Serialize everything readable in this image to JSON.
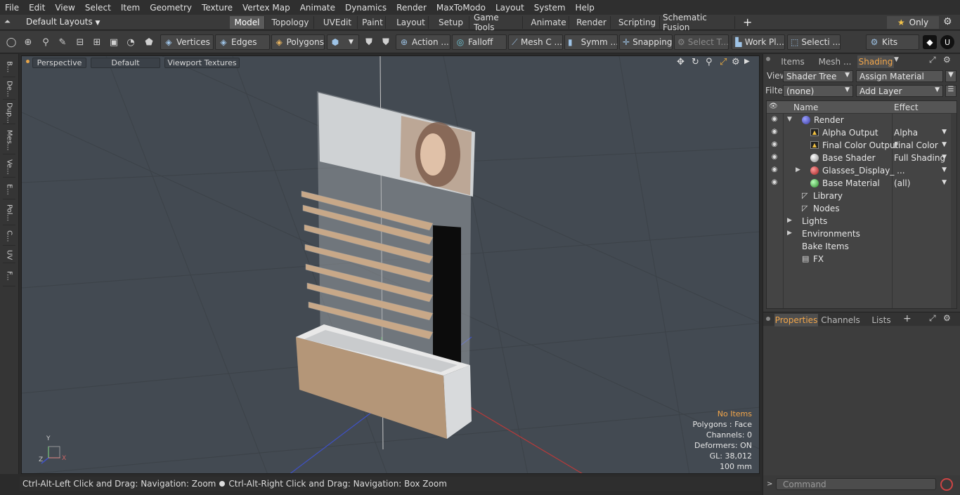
{
  "menu": [
    "File",
    "Edit",
    "View",
    "Select",
    "Item",
    "Geometry",
    "Texture",
    "Vertex Map",
    "Animate",
    "Dynamics",
    "Render",
    "MaxToModo",
    "Layout",
    "System",
    "Help"
  ],
  "layout": {
    "layouts_label": "Default Layouts",
    "tabs": [
      "Model",
      "Topology",
      "UVEdit",
      "Paint",
      "Layout",
      "Setup",
      "Game Tools",
      "Animate",
      "Render",
      "Scripting",
      "Schematic Fusion"
    ],
    "active_tab": "Model",
    "plus": "+",
    "only_label": "Only",
    "star": "★"
  },
  "toolbar": {
    "vertices": "Vertices",
    "edges": "Edges",
    "polygons": "Polygons",
    "action": "Action ...",
    "falloff": "Falloff",
    "mesh": "Mesh C ...",
    "symm": "Symm ...",
    "snapping": "Snapping",
    "select_t": "Select T...",
    "work_pl": "Work Pl...",
    "selecti": "Selecti ...",
    "kits": "Kits"
  },
  "left_tabs": [
    "B...",
    "De...",
    "Dup...",
    "Mes...",
    "Ve...",
    "E...",
    "Pol...",
    "C...",
    "UV",
    "F..."
  ],
  "viewport": {
    "perspective": "Perspective",
    "default": "Default",
    "viewport_textures": "Viewport Textures",
    "info": {
      "no_items": "No Items",
      "polygons": "Polygons : Face",
      "channels": "Channels: 0",
      "deformers": "Deformers: ON",
      "gl": "GL: 38,012",
      "scale": "100 mm"
    },
    "axis": {
      "x": "X",
      "y": "Y",
      "z": "Z"
    }
  },
  "status": {
    "hint1": "Ctrl-Alt-Left Click and Drag: Navigation: Zoom",
    "hint2": "Ctrl-Alt-Right Click and Drag: Navigation: Box Zoom"
  },
  "right": {
    "tabs": [
      "Items",
      "Mesh ...",
      "Shading"
    ],
    "active_tab": "Shading",
    "view_label": "View",
    "view_value": "Shader Tree",
    "assign_material": "Assign Material",
    "filter_label": "Filter",
    "filter_value": "(none)",
    "add_layer": "Add Layer",
    "col_name": "Name",
    "col_effect": "Effect",
    "tree": [
      {
        "name": "Render",
        "effect": "",
        "indent": 0,
        "icon": "render",
        "eye": true,
        "expander": "▼"
      },
      {
        "name": "Alpha Output",
        "effect": "Alpha",
        "indent": 1,
        "icon": "output",
        "eye": true,
        "expander": ""
      },
      {
        "name": "Final Color Output",
        "effect": "Final Color",
        "indent": 1,
        "icon": "output",
        "eye": true,
        "expander": ""
      },
      {
        "name": "Base Shader",
        "effect": "Full Shading",
        "indent": 1,
        "icon": "shader",
        "eye": true,
        "expander": ""
      },
      {
        "name": "Glasses_Display_ ...",
        "effect": "",
        "indent": 1,
        "icon": "group",
        "eye": true,
        "expander": "▶"
      },
      {
        "name": "Base Material",
        "effect": "(all)",
        "indent": 1,
        "icon": "material",
        "eye": true,
        "expander": ""
      },
      {
        "name": "Library",
        "effect": "",
        "indent": 0,
        "icon": "folder",
        "eye": false,
        "expander": ""
      },
      {
        "name": "Nodes",
        "effect": "",
        "indent": 0,
        "icon": "folder",
        "eye": false,
        "expander": ""
      },
      {
        "name": "Lights",
        "effect": "",
        "indent": 0,
        "icon": "none",
        "eye": false,
        "expander": "▶"
      },
      {
        "name": "Environments",
        "effect": "",
        "indent": 0,
        "icon": "none",
        "eye": false,
        "expander": "▶"
      },
      {
        "name": "Bake Items",
        "effect": "",
        "indent": 0,
        "icon": "none",
        "eye": false,
        "expander": ""
      },
      {
        "name": "FX",
        "effect": "",
        "indent": 0,
        "icon": "fx",
        "eye": false,
        "expander": ""
      }
    ],
    "bottom_tabs": [
      "Properties",
      "Channels",
      "Lists"
    ],
    "bottom_active": "Properties",
    "plus": "+",
    "command_placeholder": "Command"
  }
}
